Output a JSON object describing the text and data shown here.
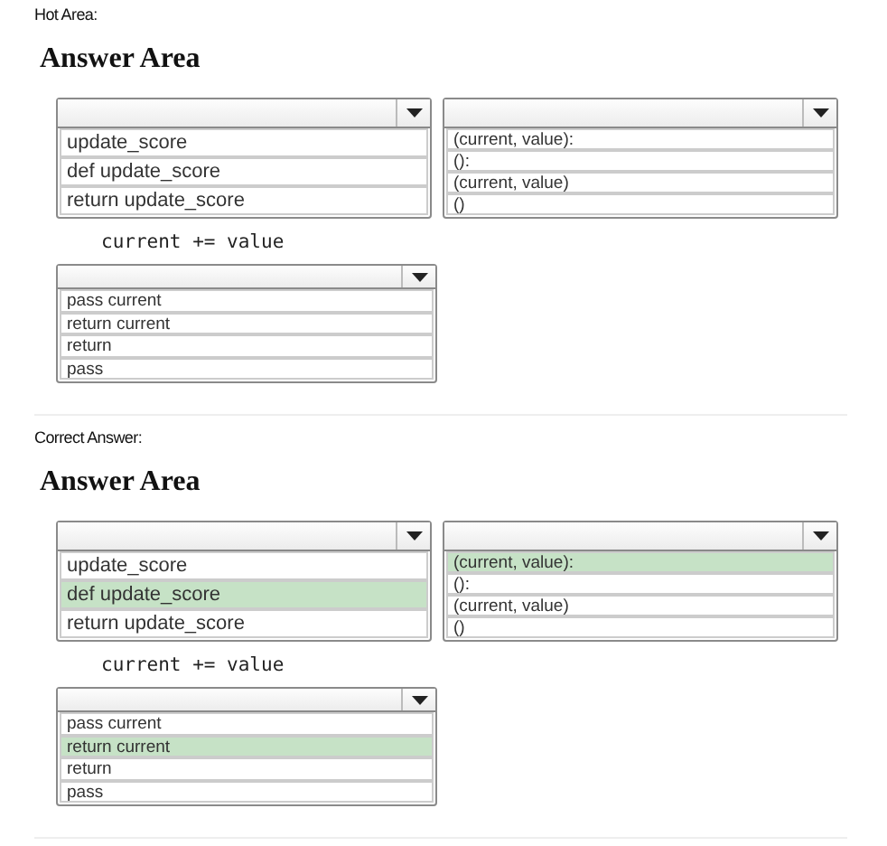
{
  "sections": [
    {
      "label": "Hot Area:",
      "heading": "Answer Area",
      "code": "current += value",
      "dropdowns": [
        {
          "options": [
            {
              "text": "update_score",
              "selected": false
            },
            {
              "text": "def update_score",
              "selected": false
            },
            {
              "text": "return update_score",
              "selected": false
            }
          ]
        },
        {
          "options": [
            {
              "text": "(current, value):",
              "selected": false
            },
            {
              "text": "():",
              "selected": false
            },
            {
              "text": "(current, value)",
              "selected": false
            },
            {
              "text": "()",
              "selected": false
            }
          ]
        },
        {
          "options": [
            {
              "text": "pass current",
              "selected": false
            },
            {
              "text": "return current",
              "selected": false
            },
            {
              "text": "return",
              "selected": false
            },
            {
              "text": "pass",
              "selected": false
            }
          ]
        }
      ]
    },
    {
      "label": "Correct Answer:",
      "heading": "Answer Area",
      "code": "current += value",
      "dropdowns": [
        {
          "options": [
            {
              "text": "update_score",
              "selected": false
            },
            {
              "text": "def update_score",
              "selected": true
            },
            {
              "text": "return update_score",
              "selected": false
            }
          ]
        },
        {
          "options": [
            {
              "text": "(current, value):",
              "selected": true
            },
            {
              "text": "():",
              "selected": false
            },
            {
              "text": "(current, value)",
              "selected": false
            },
            {
              "text": "()",
              "selected": false
            }
          ]
        },
        {
          "options": [
            {
              "text": "pass current",
              "selected": false
            },
            {
              "text": "return current",
              "selected": true
            },
            {
              "text": "return",
              "selected": false
            },
            {
              "text": "pass",
              "selected": false
            }
          ]
        }
      ]
    }
  ]
}
